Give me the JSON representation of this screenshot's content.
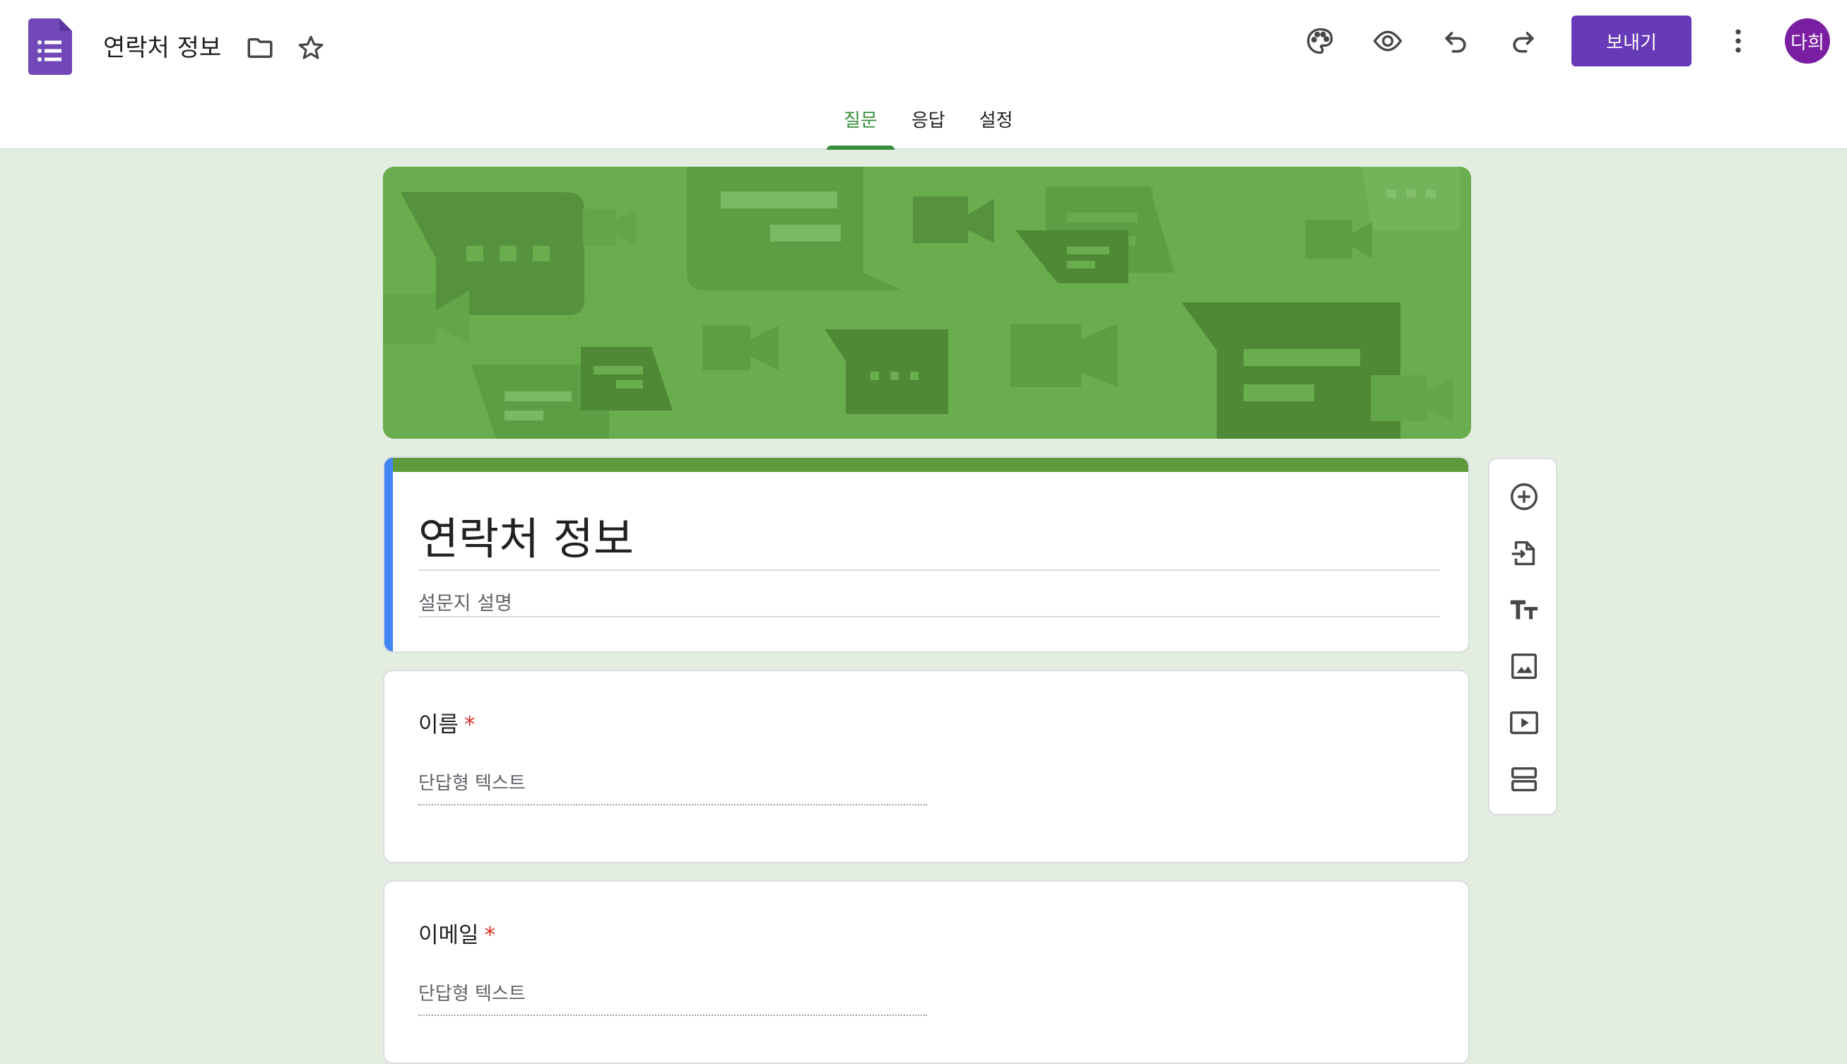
{
  "header": {
    "doc_title": "연락처 정보",
    "send_label": "보내기",
    "avatar_text": "다희",
    "brand_color": "#673ab7"
  },
  "tabs": [
    {
      "label": "질문",
      "active": true
    },
    {
      "label": "응답",
      "active": false
    },
    {
      "label": "설정",
      "active": false
    }
  ],
  "form": {
    "title": "연락처 정보",
    "description_placeholder": "설문지 설명",
    "questions": [
      {
        "label": "이름",
        "required_mark": "*",
        "placeholder": "단답형 텍스트"
      },
      {
        "label": "이메일",
        "required_mark": "*",
        "placeholder": "단답형 텍스트"
      }
    ]
  },
  "theme": {
    "banner_color": "#6aad4e",
    "accent_color": "#388e3c"
  },
  "icons": {
    "toolbar": [
      "palette-icon",
      "preview-eye-icon",
      "undo-icon",
      "redo-icon",
      "more-vert-icon"
    ],
    "sidebar": [
      "add-question-icon",
      "import-questions-icon",
      "add-title-icon",
      "add-image-icon",
      "add-video-icon",
      "add-section-icon"
    ]
  }
}
